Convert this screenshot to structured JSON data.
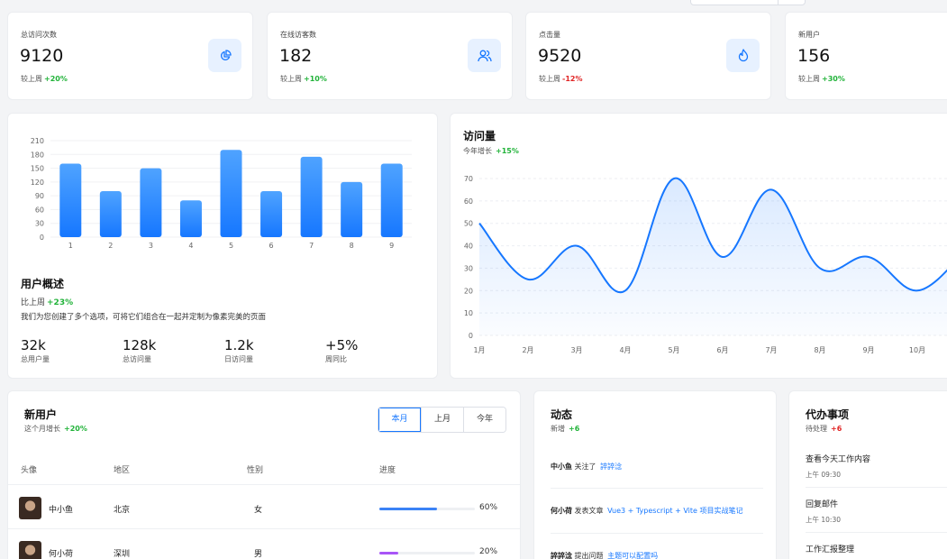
{
  "stats": [
    {
      "label": "总访问次数",
      "value": "9120",
      "compare_label": "较上周",
      "change": "+20%",
      "icon": "pie-chart-icon"
    },
    {
      "label": "在线访客数",
      "value": "182",
      "compare_label": "较上周",
      "change": "+10%",
      "icon": "users-icon"
    },
    {
      "label": "点击量",
      "value": "9520",
      "compare_label": "较上周",
      "change": "-12%",
      "icon": "fire-icon"
    },
    {
      "label": "新用户",
      "value": "156",
      "compare_label": "较上周",
      "change": "+30%",
      "icon": "user-icon"
    }
  ],
  "colors": {
    "up": "#22b33a",
    "down": "#e02424",
    "accent": "#1677ff"
  },
  "overview": {
    "title": "用户概述",
    "compare_label": "比上周",
    "change": "+23%",
    "description": "我们为您创建了多个选项，可将它们组合在一起并定制为像素完美的页面",
    "stats": [
      {
        "value": "32k",
        "label": "总用户量"
      },
      {
        "value": "128k",
        "label": "总访问量"
      },
      {
        "value": "1.2k",
        "label": "日访问量"
      },
      {
        "value": "+5%",
        "label": "周同比"
      }
    ]
  },
  "visits": {
    "title": "访问量",
    "subtitle": "今年增长",
    "change": "+15%"
  },
  "chart_data": [
    {
      "type": "bar",
      "categories": [
        "1",
        "2",
        "3",
        "4",
        "5",
        "6",
        "7",
        "8",
        "9"
      ],
      "values": [
        160,
        100,
        150,
        80,
        190,
        100,
        175,
        120,
        160
      ],
      "yticks": [
        0,
        30,
        60,
        90,
        120,
        150,
        180,
        210
      ],
      "ylim": [
        0,
        210
      ],
      "grid": true
    },
    {
      "type": "area",
      "categories": [
        "1月",
        "2月",
        "3月",
        "4月",
        "5月",
        "6月",
        "7月",
        "8月",
        "9月",
        "10月"
      ],
      "values": [
        50,
        25,
        40,
        20,
        70,
        35,
        65,
        30,
        35,
        20
      ],
      "yticks": [
        0,
        10,
        20,
        30,
        40,
        50,
        60,
        70
      ],
      "ylim": [
        0,
        70
      ],
      "grid": true
    }
  ],
  "new_users": {
    "title": "新用户",
    "subtitle": "这个月增长",
    "change": "+20%",
    "tabs": [
      "本月",
      "上月",
      "今年"
    ],
    "active_tab": "本月",
    "columns": [
      "头像",
      "地区",
      "性别",
      "进度"
    ],
    "rows": [
      {
        "name": "中小鱼",
        "region": "北京",
        "gender": "女",
        "progress": 0.6,
        "progress_label": "60%",
        "color": "#3b82f6"
      },
      {
        "name": "何小荷",
        "region": "深圳",
        "gender": "男",
        "progress": 0.2,
        "progress_label": "20%",
        "color": "#a855f7"
      }
    ]
  },
  "activity": {
    "title": "动态",
    "subtitle": "新增",
    "change": "+6",
    "items": [
      {
        "user": "中小鱼",
        "action": "关注了",
        "target": "誶誶淰"
      },
      {
        "user": "何小荷",
        "action": "发表文章",
        "target": "Vue3 + Typescript + Vite 项目实战笔记"
      },
      {
        "user": "誶誶淰",
        "action": "提出问题",
        "target": "主题可以配置吗"
      }
    ]
  },
  "todo": {
    "title": "代办事项",
    "subtitle": "待处理",
    "change": "+6",
    "items": [
      {
        "title": "查看今天工作内容",
        "time": "上午 09:30"
      },
      {
        "title": "回复邮件",
        "time": "上午 10:30"
      },
      {
        "title": "工作汇报整理",
        "time": ""
      }
    ]
  }
}
